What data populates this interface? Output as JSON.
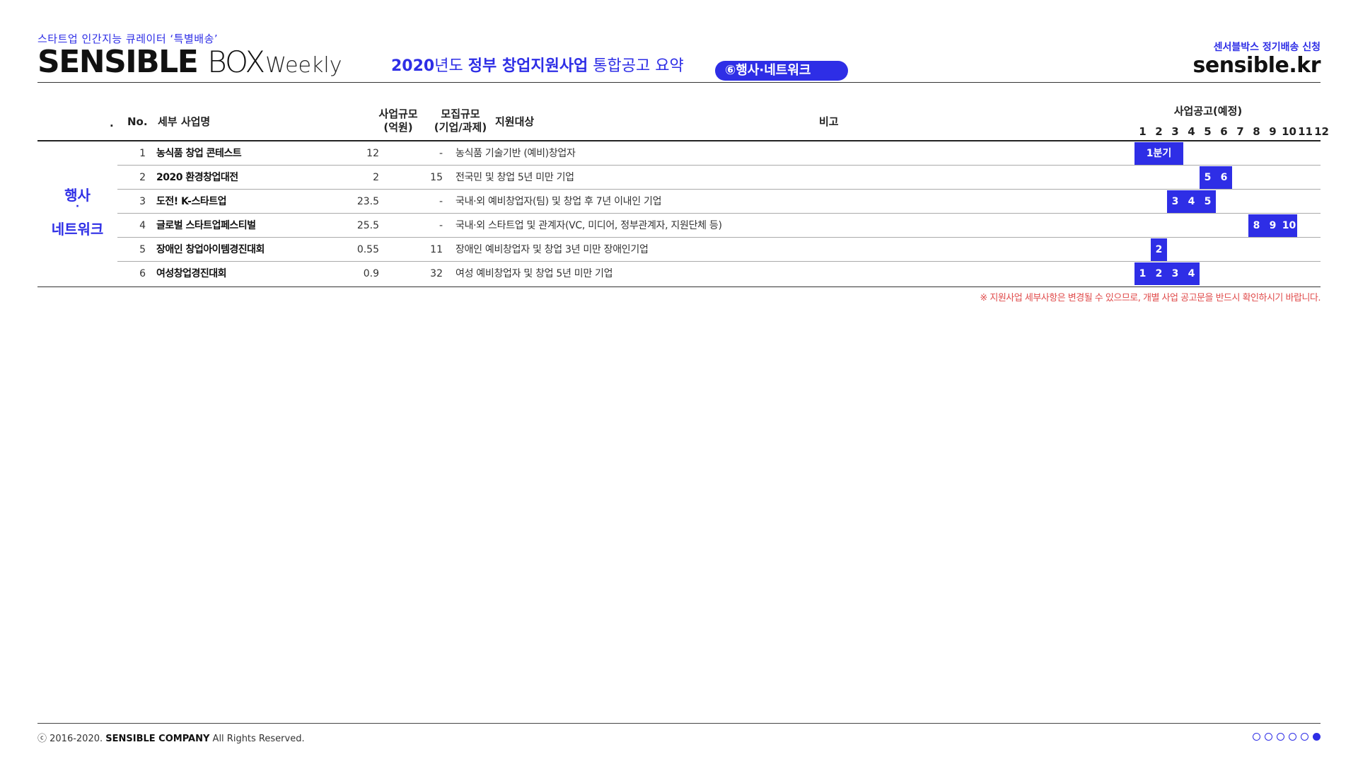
{
  "header": {
    "tagline": "스타트업 인간지능 큐레이터 ‘특별배송’",
    "brand_sensible": "SENSIBLE",
    "brand_box": "BOX",
    "brand_weekly": "Weekly",
    "headline_year": "2020",
    "headline_part1": "년도 ",
    "headline_part2": "정부 창업지원사업",
    "headline_part3": " 통합공고 요약",
    "category_pill": "⑥행사·네트워크",
    "subscribe": "센서블박스 정기배송 신청",
    "site": "sensible.kr"
  },
  "table": {
    "headers": {
      "dot": ".",
      "no": "No.",
      "name": "세부 사업명",
      "scale_line1": "사업규모",
      "scale_line2": "(억원)",
      "recruit_line1": "모집규모",
      "recruit_line2": "(기업/과제)",
      "target": "지원대상",
      "note": "비고",
      "schedule": "사업공고(예정)",
      "months": [
        "1",
        "2",
        "3",
        "4",
        "5",
        "6",
        "7",
        "8",
        "9",
        "10",
        "11",
        "12"
      ]
    },
    "category_line1": "행사",
    "category_dot": "·",
    "category_line2": "네트워크",
    "rows": [
      {
        "no": "1",
        "name": "농식품 창업 콘테스트",
        "scale": "12",
        "recruit": "-",
        "target": "농식품 기술기반 (예비)창업자",
        "bar_label": "1분기"
      },
      {
        "no": "2",
        "name": "2020 환경창업대전",
        "scale": "2",
        "recruit": "15",
        "target": "전국민 및 창업 5년 미만 기업",
        "months": [
          "5",
          "6"
        ]
      },
      {
        "no": "3",
        "name": "도전! K-스타트업",
        "scale": "23.5",
        "recruit": "-",
        "target": "국내·외 예비창업자(팀) 및 창업 후 7년 이내인 기업",
        "months": [
          "3",
          "4",
          "5"
        ]
      },
      {
        "no": "4",
        "name": "글로벌 스타트업페스티벌",
        "scale": "25.5",
        "recruit": "-",
        "target": "국내·외 스타트업 및 관계자(VC, 미디어, 정부관계자, 지원단체 등)",
        "months": [
          "8",
          "9",
          "10"
        ]
      },
      {
        "no": "5",
        "name": "장애인 창업아이템경진대회",
        "scale": "0.55",
        "recruit": "11",
        "target": "장애인 예비창업자 및 창업 3년 미만 장애인기업",
        "months": [
          "2"
        ]
      },
      {
        "no": "6",
        "name": "여성창업경진대회",
        "scale": "0.9",
        "recruit": "32",
        "target": "여성 예비창업자 및 창업 5년 미만 기업",
        "months": [
          "1",
          "2",
          "3",
          "4"
        ]
      }
    ]
  },
  "note": "※ 지원사업 세부사항은 변경될 수 있으므로, 개별 사업 공고문을 반드시 확인하시기 바랍니다.",
  "footer": {
    "copyright_prefix": "ⓒ 2016-2020.",
    "company": "SENSIBLE COMPANY",
    "rights": "All Rights Reserved."
  },
  "pager": {
    "total": 6,
    "active": 6
  },
  "colors": {
    "accent": "#2e2ee6",
    "note": "#e04b4b"
  }
}
